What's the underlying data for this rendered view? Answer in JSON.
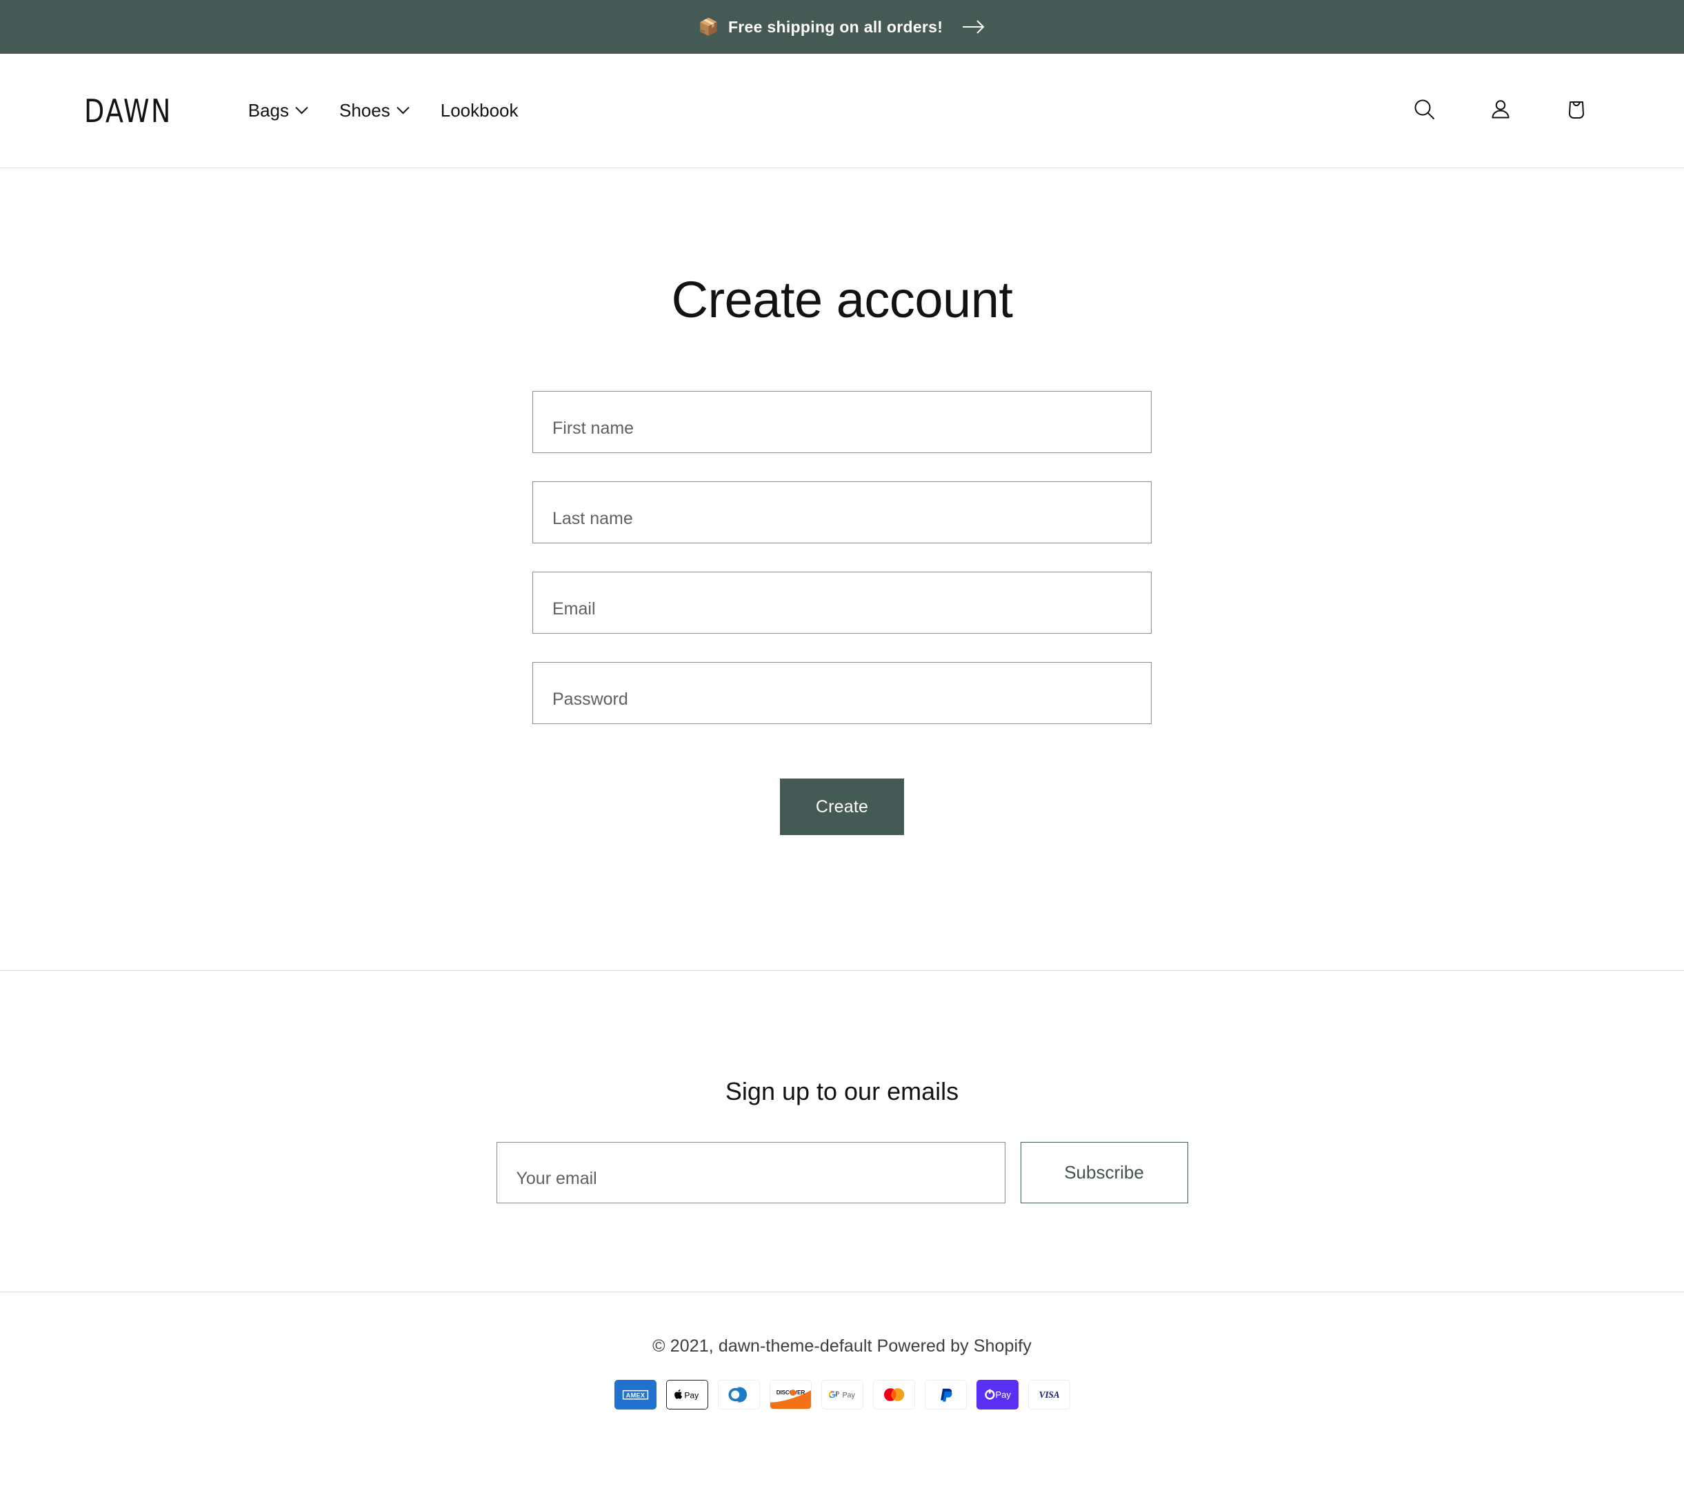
{
  "announcement": {
    "emoji": "📦",
    "text": "Free shipping on all orders!",
    "arrow_icon": "arrow-right-icon"
  },
  "header": {
    "logo": "DAWN",
    "nav": [
      {
        "label": "Bags",
        "has_dropdown": true
      },
      {
        "label": "Shoes",
        "has_dropdown": true
      },
      {
        "label": "Lookbook",
        "has_dropdown": false
      }
    ],
    "icons": [
      {
        "name": "search-icon",
        "label": "Search"
      },
      {
        "name": "account-icon",
        "label": "Log in"
      },
      {
        "name": "cart-icon",
        "label": "Cart"
      }
    ]
  },
  "main": {
    "title": "Create account",
    "fields": [
      {
        "name": "first-name",
        "placeholder": "First name",
        "value": "",
        "type": "text"
      },
      {
        "name": "last-name",
        "placeholder": "Last name",
        "value": "",
        "type": "text"
      },
      {
        "name": "email",
        "placeholder": "Email",
        "value": "",
        "type": "email"
      },
      {
        "name": "password",
        "placeholder": "Password",
        "value": "",
        "type": "password"
      }
    ],
    "submit_label": "Create"
  },
  "newsletter": {
    "heading": "Sign up to our emails",
    "placeholder": "Your email",
    "value": "",
    "subscribe_label": "Subscribe"
  },
  "footer": {
    "copyright": "© 2021, dawn-theme-default Powered by Shopify",
    "payment_methods": [
      "american-express",
      "apple-pay",
      "diners-club",
      "discover",
      "google-pay",
      "mastercard",
      "paypal",
      "shop-pay",
      "visa"
    ]
  },
  "colors": {
    "accent": "#455a55",
    "text": "#121212",
    "border": "#8a8d8e",
    "divider": "#d9dbdc",
    "shop_pay_purple": "#5a31f4",
    "amex_blue": "#1f72cd"
  }
}
